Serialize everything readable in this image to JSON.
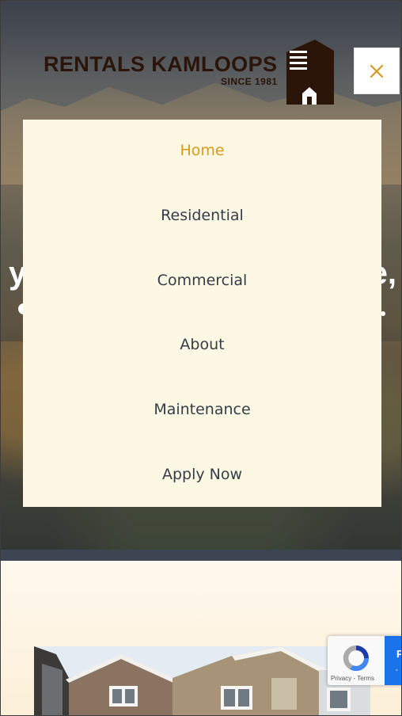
{
  "brand": {
    "name": "RENTALS KAMLOOPS",
    "since": "SINCE 1981"
  },
  "header": {
    "close_icon": "close-icon"
  },
  "nav": {
    "items": [
      {
        "label": "Home",
        "active": true
      },
      {
        "label": "Residential",
        "active": false
      },
      {
        "label": "Commercial",
        "active": false
      },
      {
        "label": "About",
        "active": false
      },
      {
        "label": "Maintenance",
        "active": false
      },
      {
        "label": "Apply Now",
        "active": false
      }
    ]
  },
  "hero": {
    "headline_left": "y",
    "headline_right": "e,"
  },
  "recaptcha": {
    "badge_text": "P",
    "links": "Privacy - Terms"
  },
  "colors": {
    "accent": "#d69a1e",
    "menu_bg": "#fdf8e3",
    "menu_text": "#333d49",
    "logo_brown": "#2a1508"
  }
}
